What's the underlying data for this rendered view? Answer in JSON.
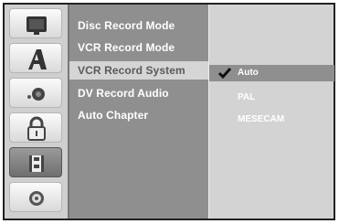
{
  "sidebar": {
    "icons": [
      {
        "name": "tv-icon"
      },
      {
        "name": "language-icon"
      },
      {
        "name": "audio-icon"
      },
      {
        "name": "lock-icon"
      },
      {
        "name": "recording-icon",
        "active": true
      },
      {
        "name": "disc-icon"
      }
    ]
  },
  "menu": {
    "items": [
      {
        "label": "Disc Record Mode"
      },
      {
        "label": "VCR Record Mode"
      },
      {
        "label": "VCR Record System",
        "selected": true
      },
      {
        "label": "DV Record Audio"
      },
      {
        "label": "Auto Chapter"
      }
    ]
  },
  "submenu": {
    "options": [
      {
        "label": "Auto",
        "selected": true
      },
      {
        "label": "PAL"
      },
      {
        "label": "MESECAM"
      }
    ]
  },
  "colors": {
    "panel": "#8f8f8f",
    "selected_text": "#5a5a5a",
    "sidebar": "#cfcfcf"
  }
}
